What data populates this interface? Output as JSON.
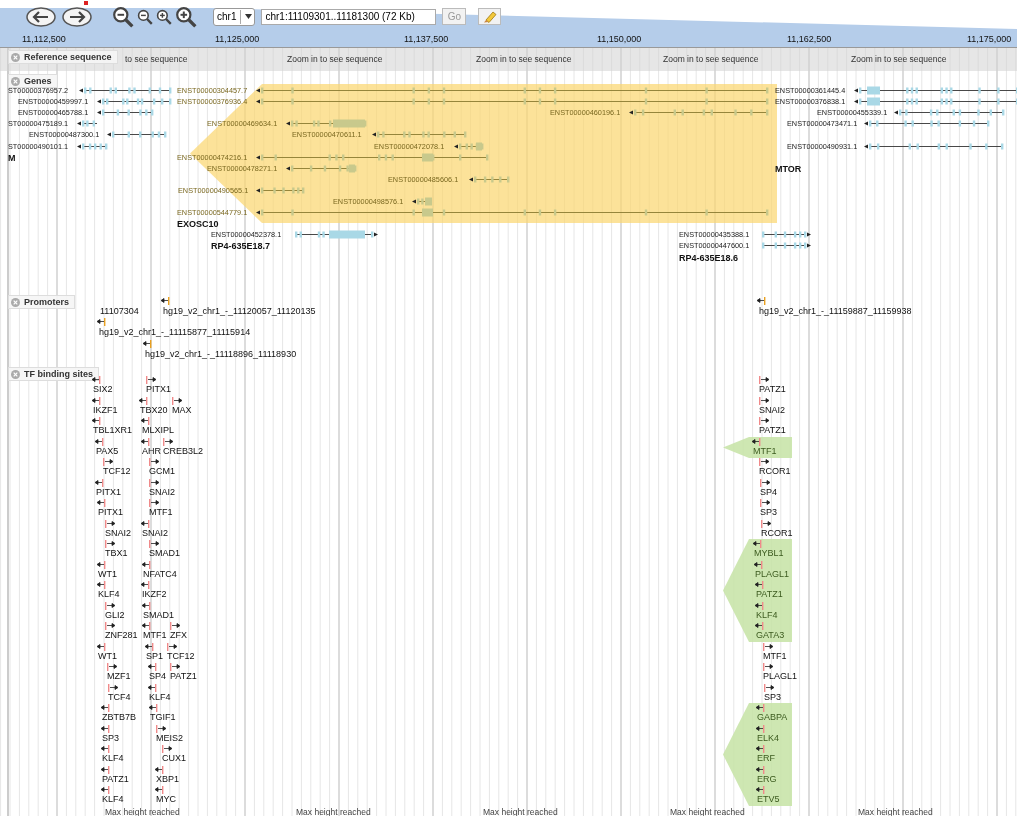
{
  "toolbar": {
    "chromosome": "chr1",
    "location": "chr1:11109301..11181300 (72 Kb)",
    "go_label": "Go",
    "go_disabled": true
  },
  "scale": {
    "ticks": [
      "11,112,500",
      "11,125,000",
      "11,137,500",
      "11,150,000",
      "11,162,500",
      "11,175,000"
    ]
  },
  "reference_sequence": {
    "label": "Reference sequence",
    "messages": [
      "to see sequence",
      "Zoom in to see sequence",
      "Zoom in to see sequence",
      "Zoom in to see sequence",
      "Zoom in to see sequence"
    ]
  },
  "genes": {
    "label": "Genes",
    "items": [
      {
        "name": "M",
        "highlighted": false,
        "transcripts": [
          {
            "id": "ST00000376957.2",
            "reverse": true
          },
          {
            "id": "ENST00000459997.1",
            "reverse": true
          },
          {
            "id": "ENST00000465788.1",
            "reverse": true
          },
          {
            "id": "ST00000475189.1",
            "reverse": true
          },
          {
            "id": "ENST00000487300.1",
            "reverse": true
          },
          {
            "id": "ST00000490101.1",
            "reverse": true
          }
        ]
      },
      {
        "name": "EXOSC10",
        "highlighted": true,
        "transcripts": [
          {
            "id": "ENST00000304457.7",
            "reverse": true
          },
          {
            "id": "ENST00000376936.4",
            "reverse": true
          },
          {
            "id": "ENST00000460196.1",
            "reverse": true
          },
          {
            "id": "ENST00000469634.1",
            "reverse": true
          },
          {
            "id": "ENST00000470611.1",
            "reverse": true
          },
          {
            "id": "ENST00000472078.1",
            "reverse": true
          },
          {
            "id": "ENST00000474216.1",
            "reverse": true
          },
          {
            "id": "ENST00000478271.1",
            "reverse": true
          },
          {
            "id": "ENST00000485606.1",
            "reverse": true
          },
          {
            "id": "ENST00000490565.1",
            "reverse": true
          },
          {
            "id": "ENST00000498576.1",
            "reverse": true
          },
          {
            "id": "ENST00000544779.1",
            "reverse": true
          }
        ]
      },
      {
        "name": "MTOR",
        "highlighted": false,
        "transcripts": [
          {
            "id": "ENST00000361445.4",
            "reverse": true
          },
          {
            "id": "ENST00000376838.1",
            "reverse": true
          },
          {
            "id": "ENST00000455339.1",
            "reverse": true
          },
          {
            "id": "ENST00000473471.1",
            "reverse": true
          },
          {
            "id": "ENST00000490931.1",
            "reverse": true
          }
        ]
      },
      {
        "name": "RP4-635E18.7",
        "highlighted": false,
        "transcripts": [
          {
            "id": "ENST00000452378.1",
            "reverse": false
          }
        ]
      },
      {
        "name": "RP4-635E18.6",
        "highlighted": false,
        "transcripts": [
          {
            "id": "ENST00000435388.1",
            "reverse": false
          },
          {
            "id": "ENST00000447600.1",
            "reverse": false
          }
        ]
      }
    ]
  },
  "promoters": {
    "label": "Promoters",
    "items": [
      {
        "name": "11107304"
      },
      {
        "name": "hg19_v2_chr1_-_11120057_11120135",
        "reverse": true
      },
      {
        "name": "hg19_v2_chr1_-_11115877_11115914",
        "reverse": true
      },
      {
        "name": "hg19_v2_chr1_-_11118896_11118930",
        "reverse": true
      },
      {
        "name": "hg19_v2_chr1_-_11159887_11159938",
        "reverse": true
      }
    ]
  },
  "tf_binding_sites": {
    "label": "TF binding sites",
    "rows": [
      [
        {
          "name": "SIX2",
          "reverse": true,
          "highlighted": false
        },
        {
          "name": "PITX1",
          "reverse": false,
          "highlighted": false
        },
        {
          "name": "PATZ1",
          "reverse": false,
          "highlighted": false
        }
      ],
      [
        {
          "name": "IKZF1",
          "reverse": true,
          "highlighted": false
        },
        {
          "name": "TBX20",
          "reverse": true,
          "highlighted": false
        },
        {
          "name": "MAX",
          "reverse": false,
          "highlighted": false
        },
        {
          "name": "SNAI2",
          "reverse": false,
          "highlighted": false
        }
      ],
      [
        {
          "name": "TBL1XR1",
          "reverse": true,
          "highlighted": false
        },
        {
          "name": "MLXIPL",
          "reverse": true,
          "highlighted": false
        },
        {
          "name": "PATZ1",
          "reverse": false,
          "highlighted": false
        }
      ],
      [
        {
          "name": "PAX5",
          "reverse": true,
          "highlighted": false
        },
        {
          "name": "AHR",
          "reverse": true,
          "highlighted": false
        },
        {
          "name": "CREB3L2",
          "reverse": false,
          "highlighted": false
        },
        {
          "name": "MTF1",
          "reverse": true,
          "highlighted": true
        }
      ],
      [
        {
          "name": "TCF12",
          "reverse": false,
          "highlighted": false
        },
        {
          "name": "GCM1",
          "reverse": false,
          "highlighted": false
        },
        {
          "name": "RCOR1",
          "reverse": false,
          "highlighted": false
        }
      ],
      [
        {
          "name": "PITX1",
          "reverse": true,
          "highlighted": false
        },
        {
          "name": "SNAI2",
          "reverse": false,
          "highlighted": false
        },
        {
          "name": "SP4",
          "reverse": false,
          "highlighted": false
        }
      ],
      [
        {
          "name": "PITX1",
          "reverse": true,
          "highlighted": false
        },
        {
          "name": "MTF1",
          "reverse": false,
          "highlighted": false
        },
        {
          "name": "SP3",
          "reverse": false,
          "highlighted": false
        }
      ],
      [
        {
          "name": "SNAI2",
          "reverse": false,
          "highlighted": false
        },
        {
          "name": "SNAI2",
          "reverse": true,
          "highlighted": false
        },
        {
          "name": "RCOR1",
          "reverse": false,
          "highlighted": false
        }
      ],
      [
        {
          "name": "TBX1",
          "reverse": false,
          "highlighted": false
        },
        {
          "name": "SMAD1",
          "reverse": false,
          "highlighted": false
        },
        {
          "name": "MYBL1",
          "reverse": true,
          "highlighted": true
        }
      ],
      [
        {
          "name": "WT1",
          "reverse": true,
          "highlighted": false
        },
        {
          "name": "NFATC4",
          "reverse": true,
          "highlighted": false
        },
        {
          "name": "PLAGL1",
          "reverse": true,
          "highlighted": true
        }
      ],
      [
        {
          "name": "KLF4",
          "reverse": true,
          "highlighted": false
        },
        {
          "name": "IKZF2",
          "reverse": true,
          "highlighted": false
        },
        {
          "name": "PATZ1",
          "reverse": true,
          "highlighted": true
        }
      ],
      [
        {
          "name": "GLI2",
          "reverse": false,
          "highlighted": false
        },
        {
          "name": "SMAD1",
          "reverse": true,
          "highlighted": false
        },
        {
          "name": "KLF4",
          "reverse": true,
          "highlighted": true
        }
      ],
      [
        {
          "name": "ZNF281",
          "reverse": false,
          "highlighted": false
        },
        {
          "name": "MTF1",
          "reverse": true,
          "highlighted": false
        },
        {
          "name": "ZFX",
          "reverse": false,
          "highlighted": false
        },
        {
          "name": "GATA3",
          "reverse": true,
          "highlighted": true
        }
      ],
      [
        {
          "name": "WT1",
          "reverse": true,
          "highlighted": false
        },
        {
          "name": "SP1",
          "reverse": true,
          "highlighted": false
        },
        {
          "name": "TCF12",
          "reverse": false,
          "highlighted": false
        },
        {
          "name": "MTF1",
          "reverse": false,
          "highlighted": false
        }
      ],
      [
        {
          "name": "MZF1",
          "reverse": false,
          "highlighted": false
        },
        {
          "name": "SP4",
          "reverse": true,
          "highlighted": false
        },
        {
          "name": "PATZ1",
          "reverse": false,
          "highlighted": false
        },
        {
          "name": "PLAGL1",
          "reverse": false,
          "highlighted": false
        }
      ],
      [
        {
          "name": "TCF4",
          "reverse": false,
          "highlighted": false
        },
        {
          "name": "KLF4",
          "reverse": true,
          "highlighted": false
        },
        {
          "name": "SP3",
          "reverse": false,
          "highlighted": false
        }
      ],
      [
        {
          "name": "ZBTB7B",
          "reverse": true,
          "highlighted": false
        },
        {
          "name": "TGIF1",
          "reverse": true,
          "highlighted": false
        },
        {
          "name": "GABPA",
          "reverse": true,
          "highlighted": true
        }
      ],
      [
        {
          "name": "SP3",
          "reverse": true,
          "highlighted": false
        },
        {
          "name": "MEIS2",
          "reverse": false,
          "highlighted": false
        },
        {
          "name": "ELK4",
          "reverse": true,
          "highlighted": true
        }
      ],
      [
        {
          "name": "KLF4",
          "reverse": true,
          "highlighted": false
        },
        {
          "name": "CUX1",
          "reverse": false,
          "highlighted": false
        },
        {
          "name": "ERF",
          "reverse": true,
          "highlighted": true
        }
      ],
      [
        {
          "name": "PATZ1",
          "reverse": true,
          "highlighted": false
        },
        {
          "name": "XBP1",
          "reverse": true,
          "highlighted": false
        },
        {
          "name": "ERG",
          "reverse": true,
          "highlighted": true
        }
      ],
      [
        {
          "name": "KLF4",
          "reverse": true,
          "highlighted": false
        },
        {
          "name": "MYC",
          "reverse": true,
          "highlighted": false
        },
        {
          "name": "ETV5",
          "reverse": true,
          "highlighted": true
        }
      ]
    ]
  },
  "footer_messages": [
    "Max height reached",
    "Max height reached",
    "Max height reached",
    "Max height reached",
    "Max height reached"
  ]
}
